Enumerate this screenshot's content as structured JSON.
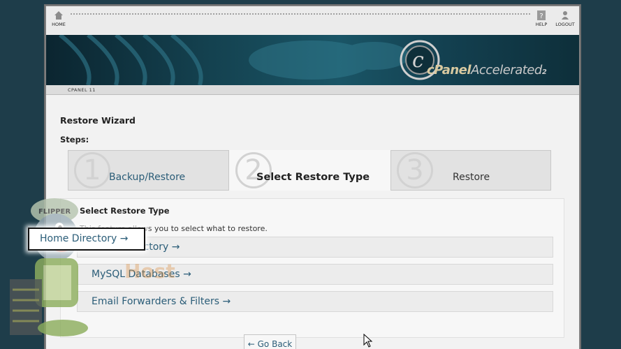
{
  "topnav": {
    "home_label": "HOME",
    "help_label": "HELP",
    "logout_label": "LOGOUT"
  },
  "banner": {
    "logo_main": "cPanel",
    "logo_accent": "Accelerated",
    "logo_sub": "2"
  },
  "breadcrumb": "CPANEL 11",
  "page": {
    "title": "Restore Wizard",
    "steps_label": "Steps:"
  },
  "steps": [
    {
      "num": "1",
      "label": "Backup/Restore"
    },
    {
      "num": "2",
      "label": "Select Restore Type"
    },
    {
      "num": "3",
      "label": "Restore"
    }
  ],
  "panel": {
    "title": "Select Restore Type",
    "description": "This feature allows you to select what to restore."
  },
  "options": [
    {
      "label": "Home Directory →"
    },
    {
      "label": "MySQL Databases →"
    },
    {
      "label": "Email Forwarders & Filters →"
    }
  ],
  "go_back_label": "← Go Back",
  "watermark": {
    "mascot_cap": "FLIPPER",
    "text": "Host"
  },
  "colors": {
    "link": "#2b5d78",
    "background": "#1e3d4a"
  }
}
